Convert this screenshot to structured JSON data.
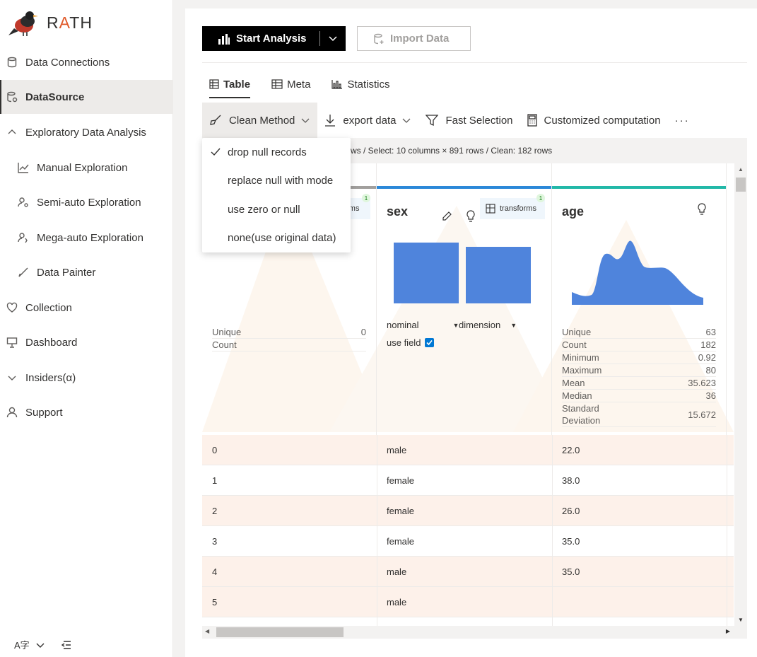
{
  "brand": {
    "name_prefix": "R",
    "name_accent": "A",
    "name_suffix": "TH"
  },
  "sidebar": {
    "items": [
      {
        "label": "Data Connections",
        "icon": "database-icon"
      },
      {
        "label": "DataSource",
        "icon": "datasource-icon",
        "active": true
      },
      {
        "label": "Exploratory Data Analysis",
        "icon": "chevron-up-icon"
      },
      {
        "label": "Manual Exploration",
        "icon": "line-chart-icon"
      },
      {
        "label": "Semi-auto Exploration",
        "icon": "person-gear-icon"
      },
      {
        "label": "Mega-auto Exploration",
        "icon": "person-gear-icon"
      },
      {
        "label": "Data Painter",
        "icon": "brush-icon"
      },
      {
        "label": "Collection",
        "icon": "heart-icon"
      },
      {
        "label": "Dashboard",
        "icon": "presentation-icon"
      },
      {
        "label": "Insiders(α)",
        "icon": "chevron-down-icon"
      },
      {
        "label": "Support",
        "icon": "person-icon"
      }
    ]
  },
  "toolbar": {
    "start_label": "Start Analysis",
    "import_label": "Import Data"
  },
  "tabs": [
    {
      "label": "Table",
      "active": true
    },
    {
      "label": "Meta"
    },
    {
      "label": "Statistics"
    }
  ],
  "commands": {
    "clean_method": "Clean Method",
    "export": "export data",
    "fast_selection": "Fast Selection",
    "customized": "Customized computation",
    "more": "···"
  },
  "info_text": "ws / Select: 10 columns × 891 rows / Clean: 182 rows",
  "dropdown": {
    "items": [
      {
        "label": "drop null records",
        "checked": true
      },
      {
        "label": "replace null with mode"
      },
      {
        "label": "use zero or null"
      },
      {
        "label": "none(use original data)"
      }
    ]
  },
  "columns": {
    "col0": {
      "transforms_label": "orms",
      "badge": "1",
      "stats": [
        {
          "label": "Unique",
          "value": "0"
        },
        {
          "label": "Count",
          "value": ""
        }
      ]
    },
    "sex": {
      "title": "sex",
      "transforms_label": "transforms",
      "badge": "1",
      "semantic_type": "nominal",
      "analytic_type": "dimension",
      "use_field_label": "use field",
      "bar_color": "#4f84dc"
    },
    "age": {
      "title": "age",
      "area_color": "#4f84dc",
      "stats": [
        {
          "label": "Unique",
          "value": "63"
        },
        {
          "label": "Count",
          "value": "182"
        },
        {
          "label": "Minimum",
          "value": "0.92"
        },
        {
          "label": "Maximum",
          "value": "80"
        },
        {
          "label": "Mean",
          "value": "35.623"
        },
        {
          "label": "Median",
          "value": "36"
        },
        {
          "label": "Standard Deviation",
          "value": "15.672"
        }
      ]
    }
  },
  "rows": [
    {
      "id": "0",
      "sex": "male",
      "age": "22.0"
    },
    {
      "id": "1",
      "sex": "female",
      "age": "38.0"
    },
    {
      "id": "2",
      "sex": "female",
      "age": "26.0"
    },
    {
      "id": "3",
      "sex": "female",
      "age": "35.0"
    },
    {
      "id": "4",
      "sex": "male",
      "age": "35.0"
    },
    {
      "id": "5",
      "sex": "male",
      "age": ""
    }
  ],
  "colors": {
    "accent_blue": "#2b88d8",
    "accent_teal": "#22b8a8",
    "accent_gray": "#a19f9d",
    "row_tint": "#fdf1ea"
  }
}
